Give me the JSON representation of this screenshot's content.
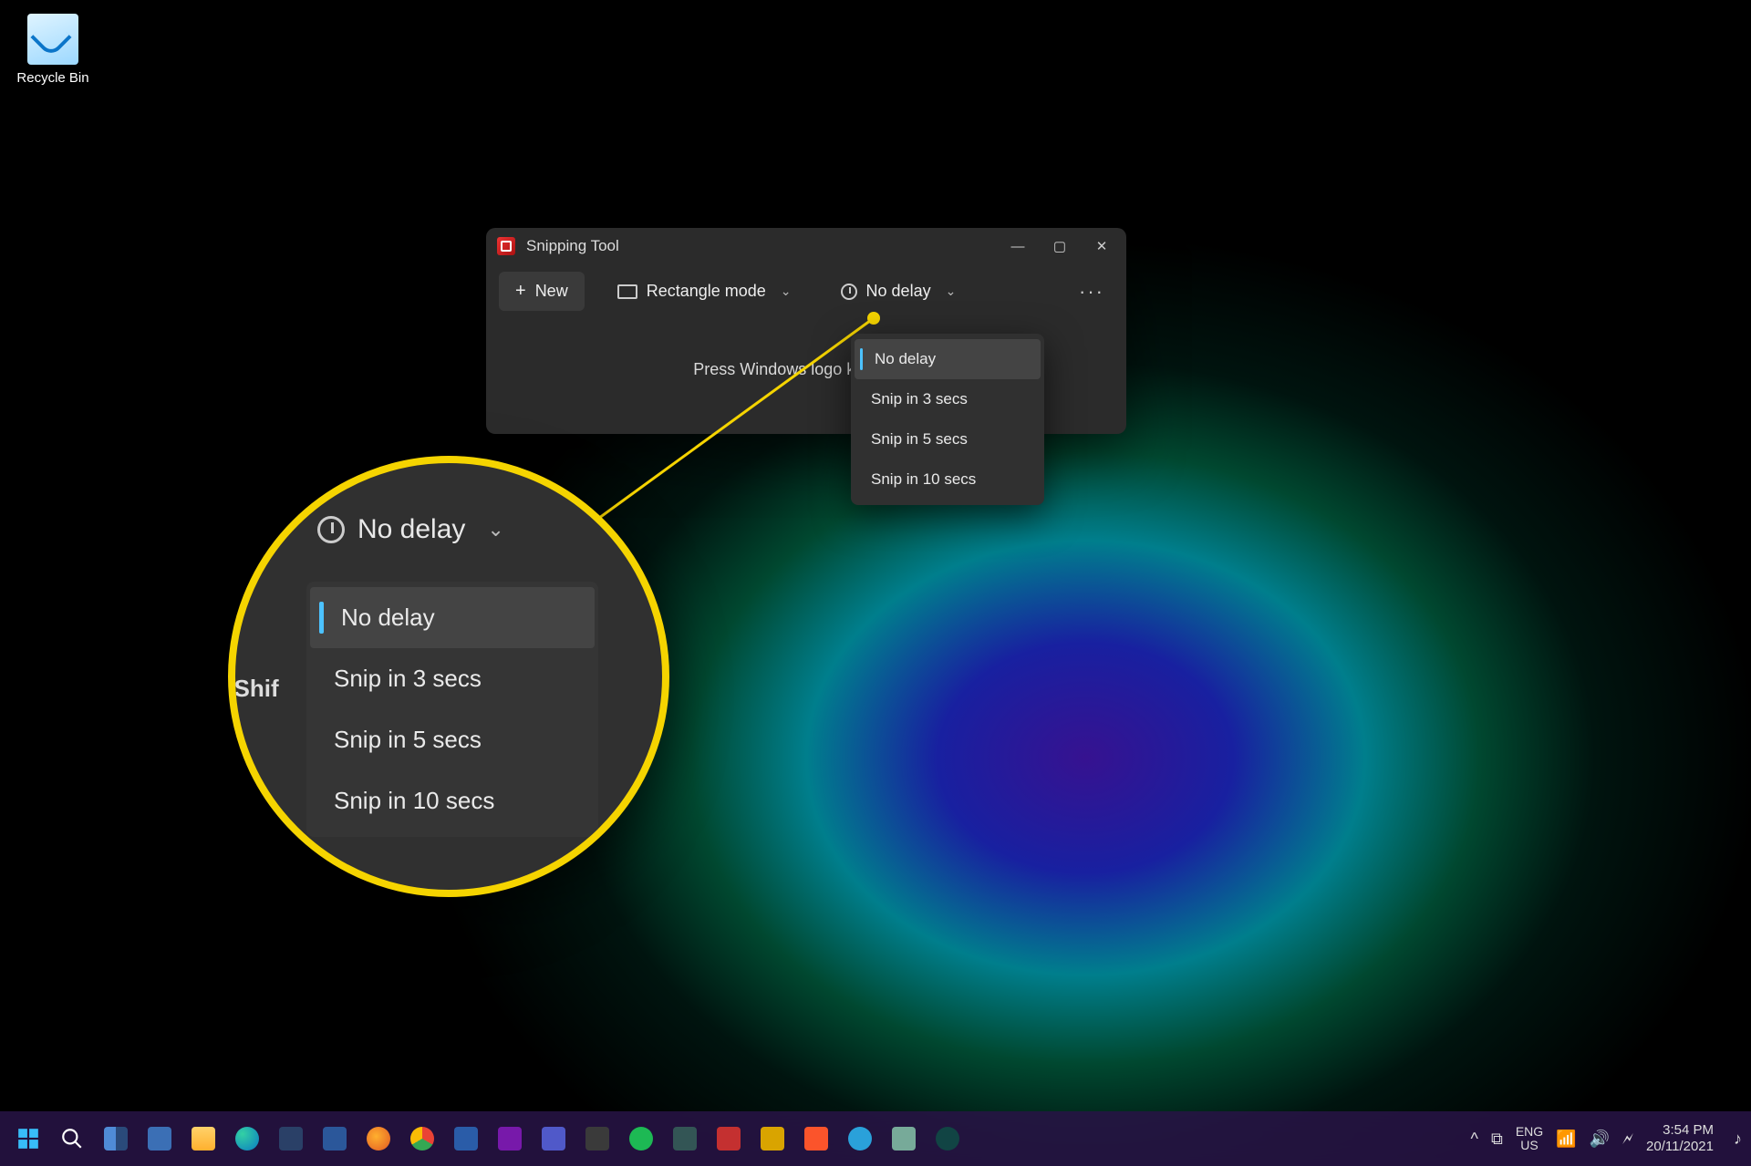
{
  "desktop": {
    "recycle_bin": "Recycle Bin"
  },
  "window": {
    "title": "Snipping Tool",
    "new_button": "New",
    "mode_label": "Rectangle mode",
    "delay_label": "No delay",
    "hint": "Press Windows logo key + Shif",
    "delay_menu": {
      "items": [
        "No delay",
        "Snip in 3 secs",
        "Snip in 5 secs",
        "Snip in 10 secs"
      ],
      "selected_index": 0
    }
  },
  "magnifier": {
    "delay_label": "No delay",
    "hint_fragment": "ey + Shif",
    "menu": {
      "items": [
        "No delay",
        "Snip in 3 secs",
        "Snip in 5 secs",
        "Snip in 10 secs"
      ],
      "selected_index": 0
    }
  },
  "taskbar": {
    "system": {
      "chevron": "^",
      "cloud": "⯊",
      "lang_top": "ENG",
      "lang_bottom": "US",
      "wifi": "⚞",
      "volume": "🔉",
      "battery": "🔋",
      "time": "3:54 PM",
      "date": "20/11/2021"
    }
  },
  "colors": {
    "accent": "#4cc2ff",
    "callout": "#f5d400"
  }
}
